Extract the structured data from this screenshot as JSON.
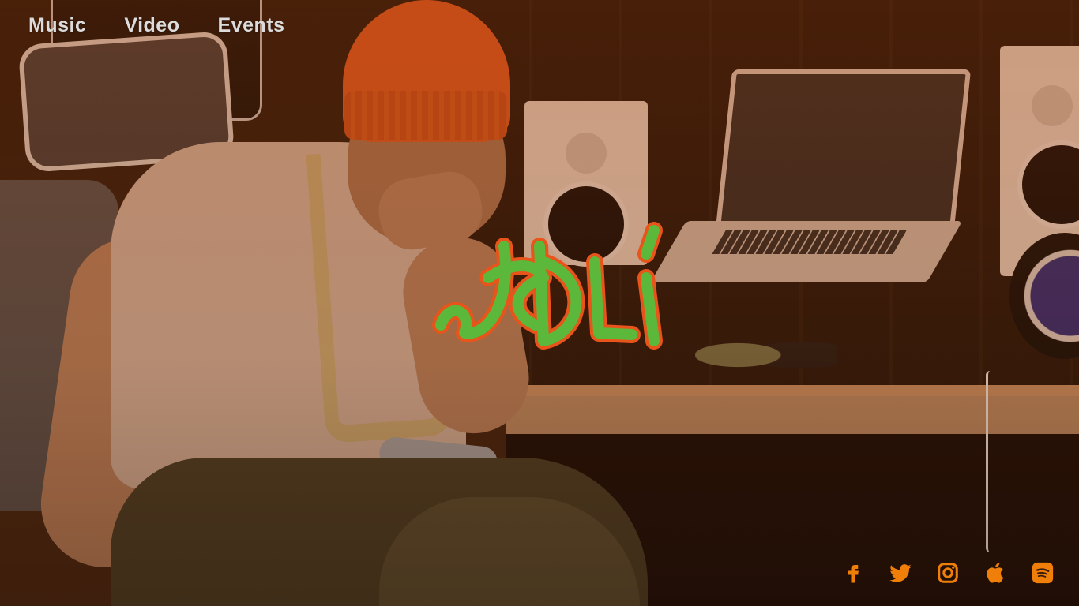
{
  "nav": {
    "items": [
      {
        "label": "Music"
      },
      {
        "label": "Video"
      },
      {
        "label": "Events"
      }
    ]
  },
  "logo": {
    "text": "Jedi",
    "fill_color": "#5cb83a",
    "outline_color": "#e8541a"
  },
  "socials": {
    "color": "#f07f0a",
    "icons": [
      "facebook-icon",
      "twitter-icon",
      "instagram-icon",
      "apple-icon",
      "spotify-icon"
    ]
  },
  "colors": {
    "nav_text": "#dcdcdc",
    "accent": "#f07f0a"
  }
}
